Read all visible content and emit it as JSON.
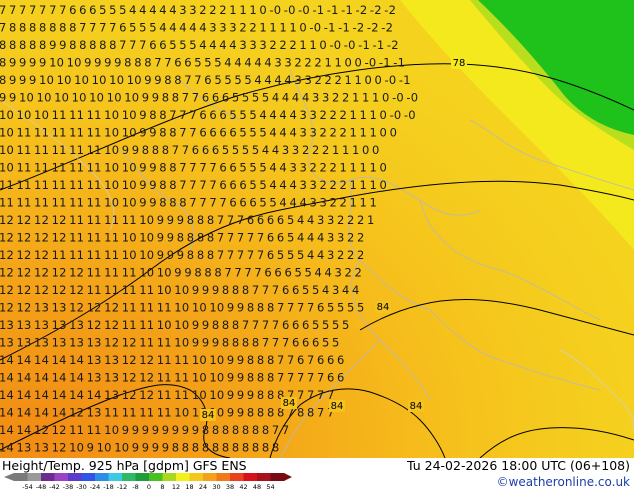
{
  "title": {
    "left": "Height/Temp. 925 hPa [gdpm] GFS ENS",
    "right": "Tu 24-02-2026 18:00 UTC (06+108)"
  },
  "credit": "©weatheronline.co.uk",
  "legend": {
    "ticks": [
      "-54",
      "-48",
      "-42",
      "-38",
      "-30",
      "-24",
      "-18",
      "-12",
      "-8",
      "0",
      "8",
      "12",
      "18",
      "24",
      "30",
      "38",
      "42",
      "48",
      "54"
    ],
    "colors": [
      "#7a7a7a",
      "#9a9a9a",
      "#6a2d8f",
      "#9b44c3",
      "#5b3cc9",
      "#2f54e6",
      "#2e8de6",
      "#3bc9e6",
      "#2fb866",
      "#1e9e3a",
      "#47c21d",
      "#a9d81c",
      "#f2f21a",
      "#f5c71a",
      "#f4a21a",
      "#f07a1a",
      "#e8431a",
      "#d4141a",
      "#a8101a",
      "#7a0a12"
    ]
  },
  "contours": [
    {
      "label": "78"
    },
    {
      "label": "84"
    },
    {
      "label": "84"
    },
    {
      "label": "84"
    },
    {
      "label": "84"
    },
    {
      "label": "84"
    }
  ],
  "grid_rows": [
    "7 7 7 7 7 7 7 6 6 6 5 5 5 4 4 4 4 4 3 3 2 2 2 1 1 1 0 -0 -0 -0 -1 -1 -1 -2 -2 -2",
    "7 8 8 8 8 8 8 8 7 7 7 7 6 5 5 5 4 4 4 4 4 3 3 3 2 2 1 1 1 1 0 -0 -1 -1 -2 -2 -2",
    "8 8 8 8 8 9 9 8 8 8 8 8 7 7 7 6 6 5 5 5 4 4 4 4 3 3 3 2 2 2 1 1 0 -0 -0 -1 -1 -2",
    "8 9 9 9 9 10 10 9 9 9 9 8 8 8 7 7 6 6 5 5 5 4 4 4 4 4 3 3 2 2 2 1 1 0 0 -0 -1 -1",
    "8 9 9 9 10 10 10 10 10 10 9 9 8 8 7 7 6 5 5 5 5 4 4 4 4 3 3 2 2 2 1 1 0 0 -0 -1",
    "9 9 10 10 10 10 10 10 10 9 9 8 8 7 7 6 6 6 5 5 5 5 4 4 4 4 3 3 2 2 1 1 1 0 -0 -0",
    "10 10 10 11 11 11 10 10 9 8 8 7 7 7 6 6 6 5 5 5 4 4 4 4 3 3 2 2 2 1 1 1 0 -0 -0",
    "10 11 11 11 11 11 10 10 9 9 8 8 7 7 6 6 6 6 5 5 5 4 4 4 3 3 2 2 2 1 1 1 0 0",
    "10 11 11 11 11 11 10 9 9 8 8 8 7 7 6 6 6 5 5 5 5 4 4 3 3 2 2 2 1 1 1 0 0",
    "10 11 11 11 11 11 10 10 9 9 8 8 7 7 7 7 6 6 5 5 5 4 4 3 3 2 2 2 1 1 1 1 0",
    "11 11 11 11 11 11 10 10 9 9 8 8 7 7 7 7 6 6 6 5 5 4 4 4 3 3 2 2 2 1 1 1 0",
    "11 11 11 11 11 11 10 10 9 9 8 8 8 7 7 7 7 6 6 6 5 5 4 4 4 3 3 2 2 1 1 1",
    "12 12 12 12 11 11 11 11 10 9 9 9 8 8 8 7 7 7 6 6 6 6 5 4 4 3 3 2 2 2 1",
    "12 12 12 12 11 11 11 10 10 9 9 8 8 8 8 7 7 7 7 7 6 6 5 4 4 4 3 3 2 2",
    "12 12 12 11 11 11 11 10 10 9 9 9 8 8 8 7 7 7 7 7 6 5 5 5 4 4 3 2 2 2",
    "12 12 12 12 12 11 11 11 10 10 9 9 8 8 8 7 7 7 7 6 6 6 5 5 4 4 3 2 2",
    "12 12 12 12 12 11 11 11 11 10 10 9 9 9 8 8 8 7 7 7 6 6 5 5 4 3 4 4",
    "12 12 13 13 12 12 12 11 11 11 10 10 10 9 9 8 8 8 7 7 7 7 6 5 5 5 5",
    "13 13 13 13 13 12 12 11 11 10 10 9 9 8 8 8 7 7 7 7 6 6 6 5 5 5 5",
    "13 13 13 13 13 13 12 12 11 11 10 9 9 9 8 8 8 8 7 7 7 6 6 6 5 5",
    "14 14 14 14 14 13 13 12 12 11 11 10 10 9 9 8 8 8 7 7 6 7 6 6 6",
    "14 14 14 14 14 13 13 12 12 11 11 10 10 9 9 8 8 8 7 7 7 7 7 6 6",
    "14 14 14 14 14 14 13 12 12 11 11 10 10 9 9 9 8 8 8 7 7 7 7 7",
    "14 14 14 14 12 13 11 11 11 11 10 10 10 9 9 8 8 8 8 7 8 8 7 7",
    "14 14 12 12 11 11 10 9 9 9 9 9 9 9 9 8 8 8 8 8 8 8 7 7",
    "14 13 13 12 10 9 10 10 9 9 9 9 8 8 8 8 8 8 8 8 8 8 8"
  ]
}
